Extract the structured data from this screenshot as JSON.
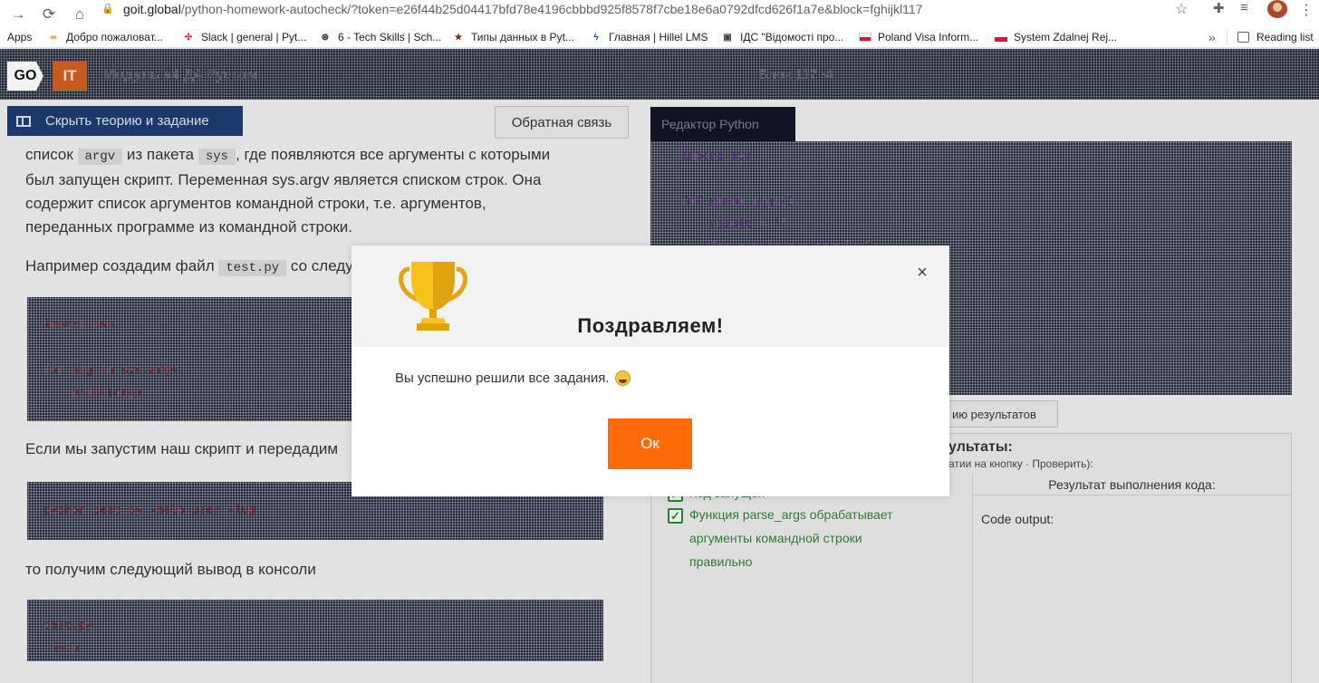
{
  "browser": {
    "url_host": "goit.global",
    "url_rest": "/python-homework-autocheck/?token=e26f44b25d04417bfd78e4196cbbbd925f8578f7cbe18e6a0792dfcd626f1a7e&block=fghijkl117",
    "bookmarks": [
      {
        "label": "Apps"
      },
      {
        "label": "Добро пожаловат..."
      },
      {
        "label": "Slack | general | Pyt..."
      },
      {
        "label": "6 - Tech Skills | Sch..."
      },
      {
        "label": "Типы данных в Pyt..."
      },
      {
        "label": "Главная | Hillel LMS"
      },
      {
        "label": "ІДС \"Відомості про..."
      },
      {
        "label": "Poland Visa Inform..."
      },
      {
        "label": "System Zdalnej Rej..."
      }
    ],
    "more_label": "»",
    "reading_list": "Reading list"
  },
  "header": {
    "logo_go": "GO",
    "logo_it": "IT",
    "module_title": "Модуль #4 Д4 Рустам",
    "center_text": "Блок 117 ·4"
  },
  "toolbar": {
    "hide_label": "Скрыть теорию и задание",
    "feedback_label": "Обратная связь"
  },
  "theory": {
    "line1_a": "список",
    "line1_code1": "argv",
    "line1_b": "из пакета",
    "line1_code2": "sys",
    "line1_c": ", где появляются все аргументы с которыми",
    "line2": "был запущен скрипт. Переменная sys.argv является списком строк. Она",
    "line3": "содержит список аргументов командной строки, т.е. аргументов,",
    "line4": "переданных программе из командной строки.",
    "para2_a": "Например создадим файл",
    "para2_code": "test.py",
    "para2_b": "со следу",
    "code1": "import sys\n\nfor arg in sys.argv:\n    print(arg)",
    "para3": "Если мы запустим наш скрипт и передадим",
    "code2": "python test.py -help user -l8g",
    "para4": "то получим следующий вывод в консоли",
    "code3": "test.py\n-help"
  },
  "editor": {
    "tab_label": "Редактор Python",
    "code": "import sys\n\ndef parse_args():\n    result = ''\n    for arg in sys.argv[1:]:\n        result += ' ' + arg"
  },
  "results": {
    "button_label": "ию результатов",
    "title": "ультаты:",
    "hint": "атии на кнопку · Проверить):",
    "column_header": "Результат выполнения кода:",
    "check1": "Код запущен",
    "check2_l1": "Функция parse_args обрабатывает",
    "check2_l2": "аргументы командной строки",
    "check2_l3": "правильно",
    "code_output": "Code output:"
  },
  "modal": {
    "title": "Поздравляем!",
    "message": "Вы успешно решили все задания.",
    "ok_label": "Ок",
    "close_label": "×"
  },
  "colors": {
    "accent_orange": "#ff6b08",
    "nav_blue": "#1b3a6b",
    "success_green": "#2e7d32"
  }
}
